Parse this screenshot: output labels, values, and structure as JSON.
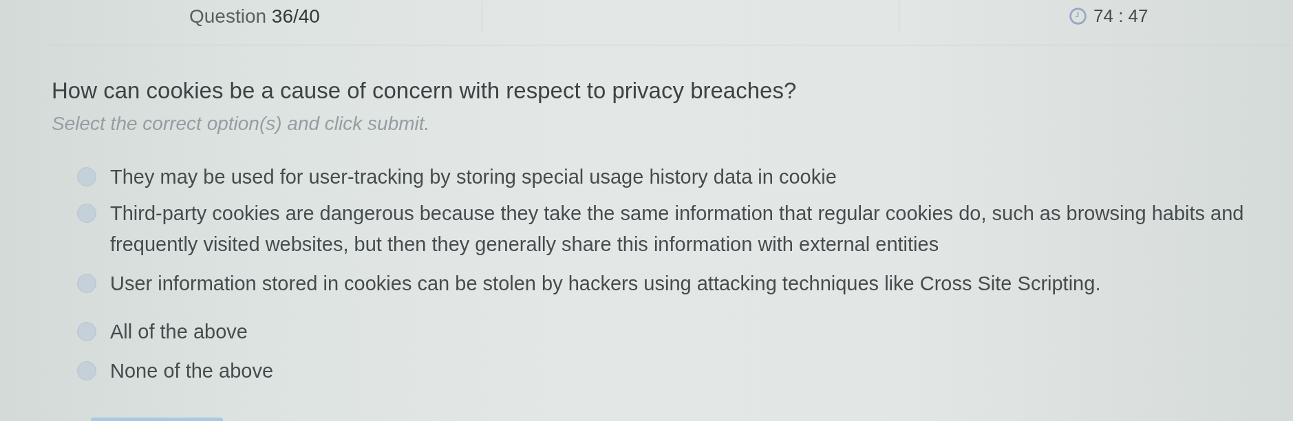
{
  "header": {
    "question_counter": "Question **36/40**",
    "timer": "74 : 47"
  },
  "question": {
    "text": "How can cookies be a cause of concern with respect to privacy breaches?",
    "instruction": "Select the correct option(s) and click submit."
  },
  "options": [
    {
      "label": "They may be used for user-tracking by storing special usage history data in cookie",
      "selected": false
    },
    {
      "label": "Third-party cookies are dangerous because they take the same information that regular cookies do, such as browsing habits and frequently visited websites, but then they generally share this information with external entities",
      "selected": false
    },
    {
      "label": "User information stored in cookies can be stolen by hackers using attacking techniques like Cross Site Scripting.",
      "selected": false
    },
    {
      "label": "All of the above",
      "selected": false
    },
    {
      "label": "None of the above",
      "selected": false
    }
  ]
}
